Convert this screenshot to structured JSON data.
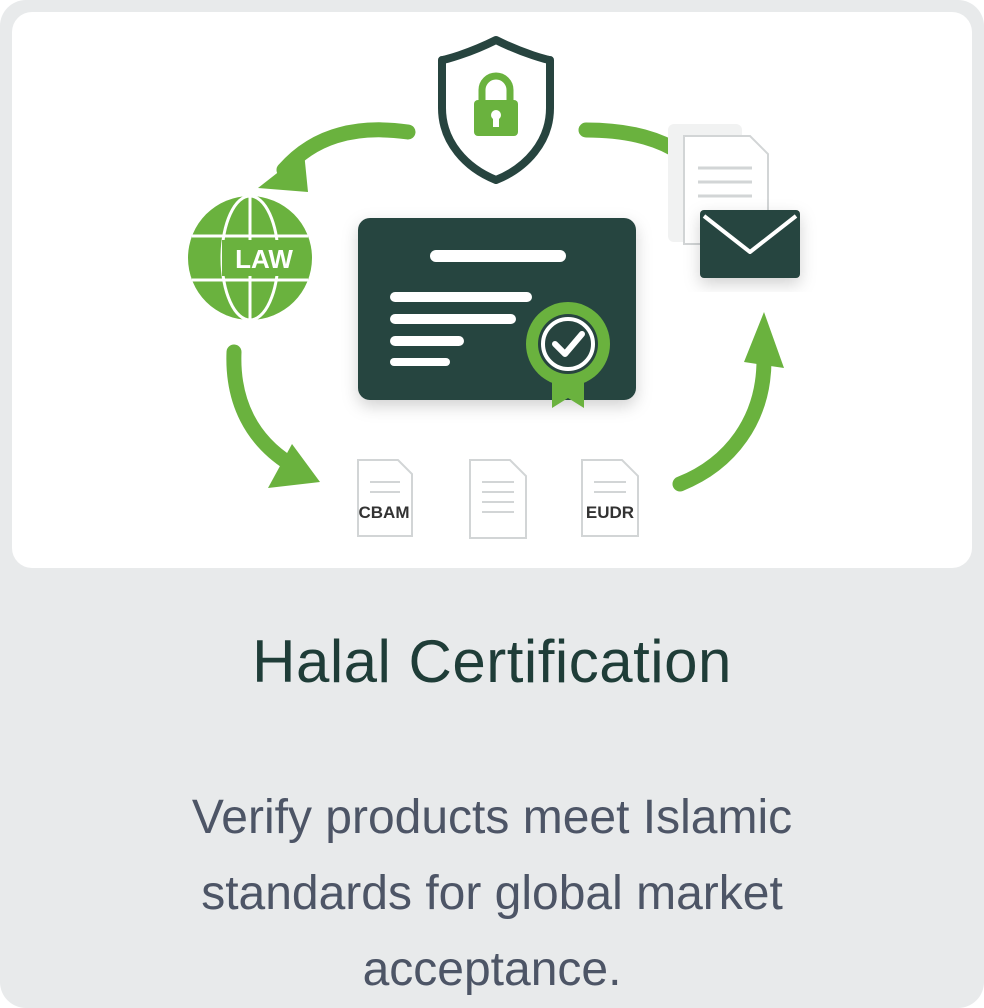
{
  "card": {
    "title": "Halal Certification",
    "description": "Verify products meet Islamic standards for global market acceptance."
  },
  "illustration": {
    "globe_label": "LAW",
    "doc_left_label": "CBAM",
    "doc_right_label": "EUDR",
    "icons": [
      "shield-lock-icon",
      "globe-icon",
      "certificate-icon",
      "seal-check-icon",
      "documents-icon",
      "envelope-icon",
      "document-icon"
    ]
  },
  "colors": {
    "green": "#6ab23e",
    "dark": "#27443f",
    "title": "#1f3d38",
    "body": "#4d5566",
    "card_bg": "#e8eaeb"
  }
}
